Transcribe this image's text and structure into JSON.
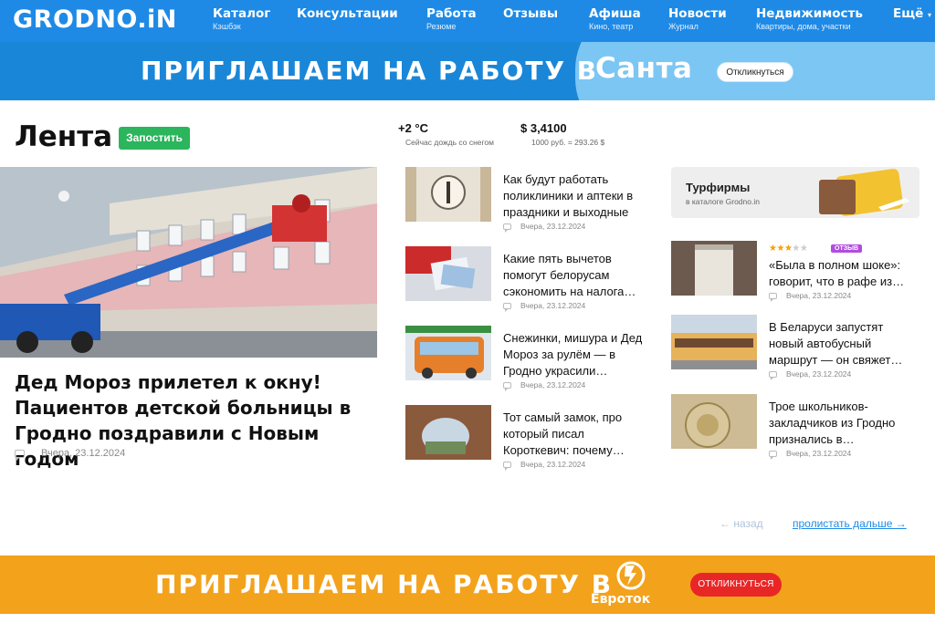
{
  "header": {
    "logo": "GRODNO.iN",
    "nav": [
      {
        "label": "Каталог",
        "sub": "Кэшбэк"
      },
      {
        "label": "Консультации",
        "sub": ""
      },
      {
        "label": "Работа",
        "sub": "Резюме"
      },
      {
        "label": "Отзывы",
        "sub": ""
      },
      {
        "label": "Афиша",
        "sub": "Кино, театр"
      },
      {
        "label": "Новости",
        "sub": "Журнал"
      },
      {
        "label": "Недвижимость",
        "sub": "Квартиры, дома, участки"
      },
      {
        "label": "Ещё",
        "sub": ""
      }
    ]
  },
  "banner_top": {
    "text": "ПРИГЛАШАЕМ НА РАБОТУ В",
    "brand": "Санта",
    "cta": "Откликнуться"
  },
  "feed": {
    "title": "Лента",
    "post_button": "Запостить",
    "hero": {
      "title": "Дед Мороз прилетел к окну! Пациентов детской больницы в Гродно поздравили с Новым годом",
      "date": "Вчера, 23.12.2024"
    }
  },
  "weather": {
    "temp": "+2 °C",
    "desc": "Сейчас дождь со снегом"
  },
  "currency": {
    "value": "$ 3,4100",
    "desc": "1000 руб. = 293.26 $"
  },
  "news_mid": [
    {
      "title": "Как будут работать поликлиники и аптеки в праздники и выходные",
      "date": "Вчера, 23.12.2024"
    },
    {
      "title": "Какие пять вычетов помогут белорусам сэкономить на налога…",
      "date": "Вчера, 23.12.2024"
    },
    {
      "title": "Снежинки, мишура и Дед Мороз за рулём — в Гродно украсили…",
      "date": "Вчера, 23.12.2024"
    },
    {
      "title": "Тот самый замок, про который писал Короткевич: почему…",
      "date": "Вчера, 23.12.2024"
    }
  ],
  "tours": {
    "title": "Турфирмы",
    "sub": "в каталоге Grodno.in"
  },
  "news_right": [
    {
      "title": "«Была в полном шоке»: говорит, что в рафе из…",
      "date": "Вчера, 23.12.2024",
      "rating": 3,
      "badge": "ОТЗЫВ"
    },
    {
      "title": "В Беларуси запустят новый автобусный маршрут — он свяжет…",
      "date": "Вчера, 23.12.2024"
    },
    {
      "title": "Трое школьников-закладчиков из Гродно признались в…",
      "date": "Вчера, 23.12.2024"
    }
  ],
  "pager": {
    "back": "← назад",
    "next": "пролистать дальше →"
  },
  "banner_bottom": {
    "text": "ПРИГЛАШАЕМ НА РАБОТУ В",
    "brand": "Евроток",
    "cta": "ОТКЛИКНУТЬСЯ"
  },
  "colors": {
    "brand_blue": "#1e8ae6",
    "green": "#2bb55c",
    "orange": "#f3a21b",
    "red": "#e92626"
  }
}
